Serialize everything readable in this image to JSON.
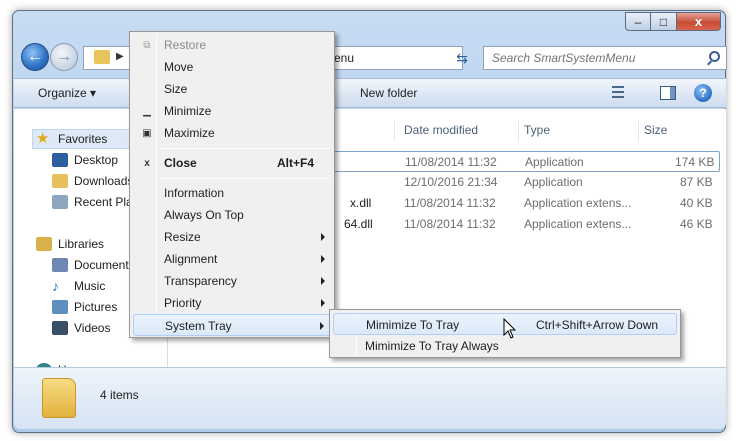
{
  "address": {
    "path_text": "enu"
  },
  "search": {
    "placeholder": "Search SmartSystemMenu"
  },
  "toolbar": {
    "organize_label": "Organize ▾",
    "new_folder_label": "New folder",
    "help_label": "?"
  },
  "caption": {
    "minimize": "–",
    "maximize": "□",
    "close": "x"
  },
  "nav": {
    "favorites": "Favorites",
    "desktop": "Desktop",
    "downloads": "Downloads",
    "recent_places": "Recent Places",
    "libraries": "Libraries",
    "documents": "Documents",
    "music": "Music",
    "pictures": "Pictures",
    "videos": "Videos",
    "homegroup": "Homegroup"
  },
  "files": {
    "columns": {
      "date_modified": "Date modified",
      "type": "Type",
      "size": "Size"
    },
    "rows": [
      {
        "name": "",
        "date": "11/08/2014 11:32",
        "type": "Application",
        "size": "174 KB"
      },
      {
        "name": "",
        "date": "12/10/2016 21:34",
        "type": "Application",
        "size": "87 KB"
      },
      {
        "name": "x.dll",
        "date": "11/08/2014 11:32",
        "type": "Application extens...",
        "size": "40 KB"
      },
      {
        "name": "64.dll",
        "date": "11/08/2014 11:32",
        "type": "Application extens...",
        "size": "46 KB"
      }
    ]
  },
  "details": {
    "item_count": "4 items"
  },
  "menu": {
    "restore": "Restore",
    "move": "Move",
    "size": "Size",
    "minimize": "Minimize",
    "maximize": "Maximize",
    "close": "Close",
    "close_shortcut": "Alt+F4",
    "information": "Information",
    "always_on_top": "Always On Top",
    "resize": "Resize",
    "alignment": "Alignment",
    "transparency": "Transparency",
    "priority": "Priority",
    "system_tray": "System Tray"
  },
  "submenu": {
    "minimize_to_tray": "Mimimize To Tray",
    "minimize_to_tray_shortcut": "Ctrl+Shift+Arrow Down",
    "minimize_to_tray_always": "Mimimize To Tray Always"
  }
}
